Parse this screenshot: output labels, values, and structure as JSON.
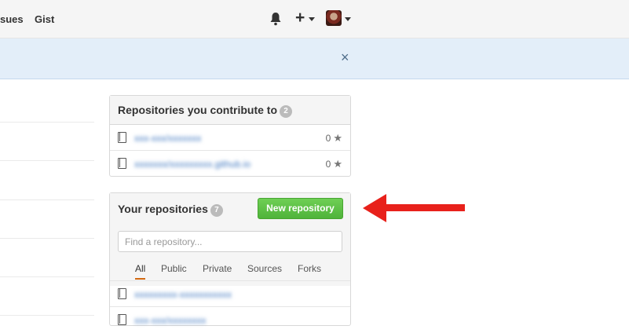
{
  "header": {
    "nav": [
      {
        "label": "sues"
      },
      {
        "label": "Gist"
      }
    ],
    "icons": [
      "bell-icon",
      "plus-icon",
      "avatar"
    ]
  },
  "flash": {
    "close_label": "×"
  },
  "contrib": {
    "title": "Repositories you contribute to",
    "count": "2",
    "repos": [
      {
        "name": "xxx-xxx/xxxxxxx",
        "stars": "0"
      },
      {
        "name": "xxxxxxx/xxxxxxxxx.github.io",
        "stars": "0"
      }
    ]
  },
  "repos": {
    "title": "Your repositories",
    "count": "7",
    "new_button": "New repository",
    "search_placeholder": "Find a repository...",
    "tabs": [
      "All",
      "Public",
      "Private",
      "Sources",
      "Forks"
    ],
    "list": [
      {
        "name": "xxxxxxxxx-xxxxxxxxxxx"
      },
      {
        "name": "xxx-xxx/xxxxxxxx"
      }
    ]
  },
  "colors": {
    "accent_green": "#55b63d",
    "arrow_red": "#e8211b",
    "link_blue": "#4078c0"
  }
}
